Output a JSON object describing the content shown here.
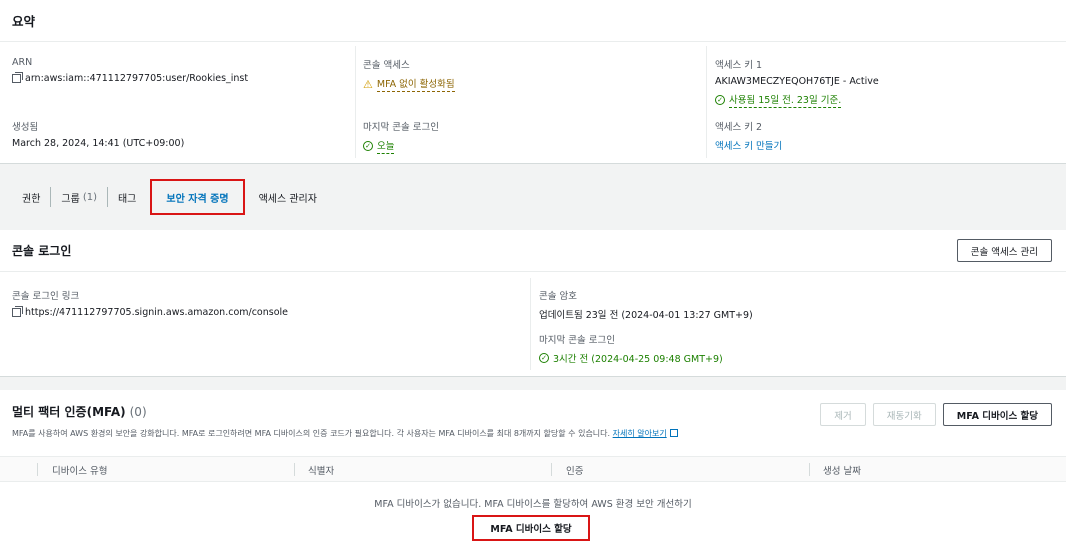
{
  "summary": {
    "title": "요약",
    "arn_label": "ARN",
    "arn_value": "arn:aws:iam::471112797705:user/Rookies_inst",
    "created_label": "생성됨",
    "created_value": "March 28, 2024, 14:41 (UTC+09:00)",
    "console_access_label": "콘솔 액세스",
    "console_access_value": "MFA 없이 활성화됨",
    "last_console_login_label": "마지막 콘솔 로그인",
    "last_console_login_value": "오늘",
    "access_key1_label": "액세스 키 1",
    "access_key1_value": "AKIAW3MECZYEQOH76TJE - Active",
    "access_key1_used": "사용됨 15일 전. 23일 기준.",
    "access_key2_label": "액세스 키 2",
    "access_key2_link": "액세스 키 만들기"
  },
  "tabs": [
    {
      "label": "권한"
    },
    {
      "label": "그룹",
      "count": "(1)"
    },
    {
      "label": "태그"
    },
    {
      "label": "보안 자격 증명"
    },
    {
      "label": "액세스 관리자"
    }
  ],
  "console_login": {
    "title": "콘솔 로그인",
    "manage_button": "콘솔 액세스 관리",
    "link_label": "콘솔 로그인 링크",
    "link_value": "https://471112797705.signin.aws.amazon.com/console",
    "password_label": "콘솔 암호",
    "password_value": "업데이트됨 23일 전 (2024-04-01 13:27 GMT+9)",
    "last_login_label": "마지막 콘솔 로그인",
    "last_login_value": "3시간 전 (2024-04-25 09:48 GMT+9)"
  },
  "mfa": {
    "title": "멀티 팩터 인증(MFA)",
    "count": "(0)",
    "description": "MFA를 사용하여 AWS 환경의 보안을 강화합니다. MFA로 로그인하려면 MFA 디바이스의 인증 코드가 필요합니다. 각 사용자는 MFA 디바이스를 최대 8개까지 할당할 수 있습니다.",
    "learn_more": "자세히 알아보기",
    "remove_button": "제거",
    "resync_button": "재동기화",
    "assign_button": "MFA 디바이스 할당",
    "columns": [
      "디바이스 유형",
      "식별자",
      "인증",
      "생성 날짜"
    ],
    "empty_text": "MFA 디바이스가 없습니다. MFA 디바이스를 할당하여 AWS 환경 보안 개선하기",
    "empty_assign_button": "MFA 디바이스 할당"
  },
  "colors": {
    "link": "#0073bb",
    "success": "#1d8102",
    "warning": "#8d6605",
    "highlight": "#d91515"
  }
}
